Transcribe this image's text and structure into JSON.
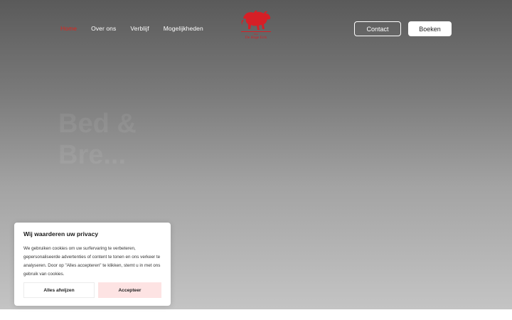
{
  "nav": {
    "items": [
      {
        "label": "Home",
        "active": true
      },
      {
        "label": "Over ons",
        "active": false
      },
      {
        "label": "Verblijf",
        "active": false
      },
      {
        "label": "Mogelijkheden",
        "active": false
      }
    ]
  },
  "logo": {
    "icon": "horses-logo-icon",
    "small_text": "Hoe",
    "text": "De Hoge Erik"
  },
  "header": {
    "contact_label": "Contact",
    "book_label": "Boeken"
  },
  "hero": {
    "title": "Bed & Bre..."
  },
  "cookie": {
    "title": "Wij waarderen uw privacy",
    "text": "We gebruiken cookies om uw surfervaring te verbeteren, gepersonaliseerde advertenties of content te tonen en ons verkeer te analyseren. Door op \"Alles accepteren\" te klikken, stemt u in met ons gebruik van cookies.",
    "reject_label": "Alles afwijzen",
    "accept_label": "Accepteer"
  },
  "colors": {
    "accent": "#e0231b",
    "logo_red": "#d61f26",
    "accept_bg": "#fde3e3"
  }
}
